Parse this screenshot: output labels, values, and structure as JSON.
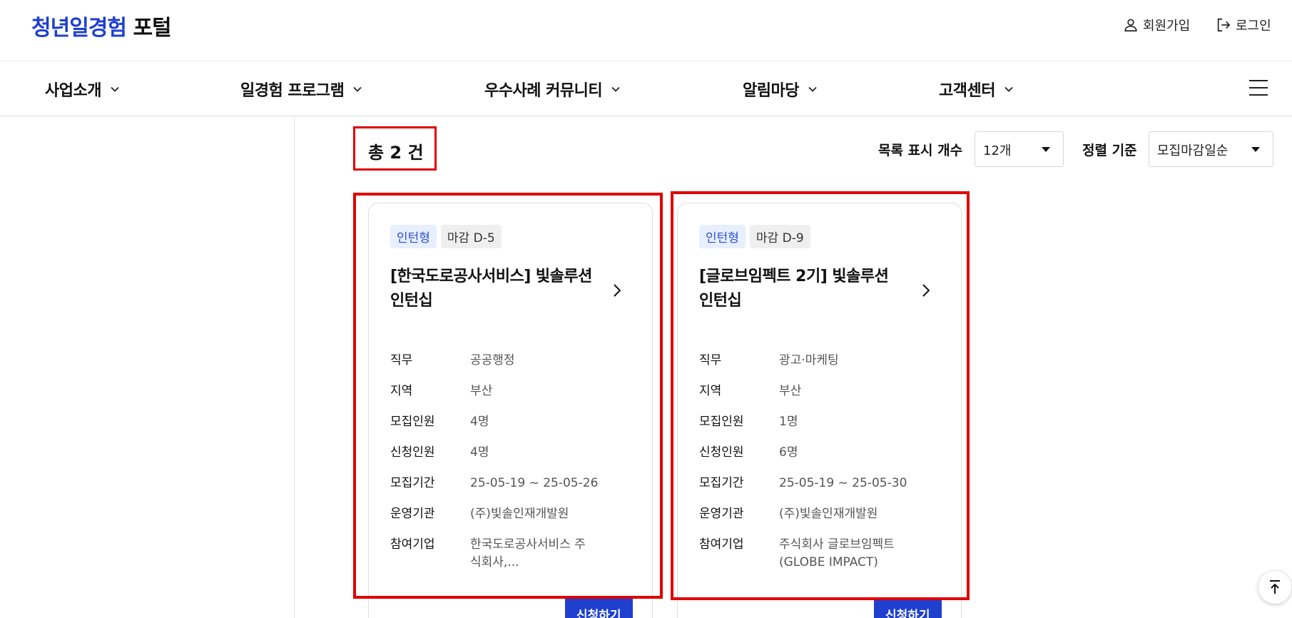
{
  "header": {
    "logo_main": "청년일경험",
    "logo_sub": "포털",
    "signup_label": "회원가입",
    "login_label": "로그인"
  },
  "nav": {
    "items": [
      {
        "label": "사업소개"
      },
      {
        "label": "일경험 프로그램"
      },
      {
        "label": "우수사례 커뮤니티"
      },
      {
        "label": "알림마당"
      },
      {
        "label": "고객센터"
      }
    ]
  },
  "toolbar": {
    "total": "총 2 건",
    "page_size_label": "목록 표시 개수",
    "page_size_value": "12개",
    "sort_label": "정렬 기준",
    "sort_value": "모집마감일순"
  },
  "cards": [
    {
      "type": "인턴형",
      "dday": "마감 D-5",
      "title": "[한국도로공사서비스] 빛솔루션 인턴십",
      "rows": [
        {
          "k": "직무",
          "v": "공공행정"
        },
        {
          "k": "지역",
          "v": "부산"
        },
        {
          "k": "모집인원",
          "v": "4명"
        },
        {
          "k": "신청인원",
          "v": "4명"
        },
        {
          "k": "모집기간",
          "v": "25-05-19 ~ 25-05-26"
        },
        {
          "k": "운영기관",
          "v": "(주)빛솔인재개발원"
        },
        {
          "k": "참여기업",
          "v": "한국도로공사서비스 주식회사,..."
        }
      ],
      "apply_label": "신청하기"
    },
    {
      "type": "인턴형",
      "dday": "마감 D-9",
      "title": "[글로브임펙트 2기] 빛솔루션 인턴십",
      "rows": [
        {
          "k": "직무",
          "v": "광고·마케팅"
        },
        {
          "k": "지역",
          "v": "부산"
        },
        {
          "k": "모집인원",
          "v": "1명"
        },
        {
          "k": "신청인원",
          "v": "6명"
        },
        {
          "k": "모집기간",
          "v": "25-05-19 ~ 25-05-30"
        },
        {
          "k": "운영기관",
          "v": "(주)빛솔인재개발원"
        },
        {
          "k": "참여기업",
          "v": "주식회사 글로브임펙트 (GLOBE IMPACT)"
        }
      ],
      "apply_label": "신청하기"
    }
  ],
  "colors": {
    "brand": "#1f3fcf",
    "highlight": "#e00000",
    "tag_bg": "#e8efff"
  },
  "icons": [
    "person-icon",
    "login-icon",
    "chevron-down-icon",
    "hamburger-icon",
    "chevron-right-icon",
    "arrow-up-icon"
  ]
}
